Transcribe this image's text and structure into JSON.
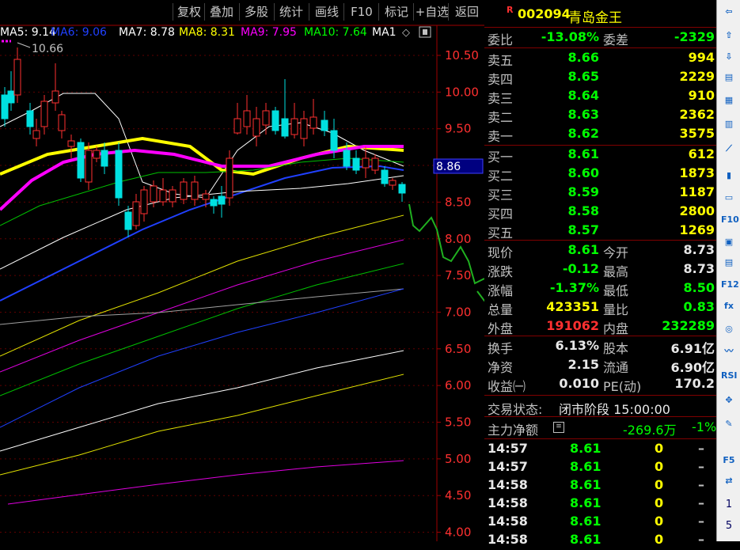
{
  "toolbar": {
    "items": [
      "复权",
      "叠加",
      "多股",
      "统计",
      "画线",
      "F10",
      "标记",
      "+自选",
      "返回"
    ]
  },
  "ma_legend": [
    {
      "label": "MA5: 9.14",
      "color": "#ffffff"
    },
    {
      "label": "MA6: 9.06",
      "color": "#2040ff"
    },
    {
      "label": "MA7: 8.78",
      "color": "#ffffff"
    },
    {
      "label": "MA8: 8.31",
      "color": "#ffff00"
    },
    {
      "label": "MA9: 7.95",
      "color": "#ff00ff"
    },
    {
      "label": "MA10: 7.64",
      "color": "#00ff00"
    },
    {
      "label": "MA1",
      "color": "#ffffff"
    }
  ],
  "high_marker": "10.66",
  "price_axis": [
    "10.50",
    "10.00",
    "9.50",
    "9.00",
    "8.50",
    "8.00",
    "7.50",
    "7.00",
    "6.50",
    "6.00",
    "5.50",
    "5.00",
    "4.50",
    "4.00"
  ],
  "current_price_tag": "8.86",
  "stock": {
    "badge": "R",
    "code": "002094",
    "name": "青岛金王"
  },
  "weibi": {
    "l1": "委比",
    "v1": "-13.08%",
    "l2": "委差",
    "v2": "-2329"
  },
  "asks": [
    {
      "label": "卖五",
      "price": "8.66",
      "vol": "994"
    },
    {
      "label": "卖四",
      "price": "8.65",
      "vol": "2229"
    },
    {
      "label": "卖三",
      "price": "8.64",
      "vol": "910"
    },
    {
      "label": "卖二",
      "price": "8.63",
      "vol": "2362"
    },
    {
      "label": "卖一",
      "price": "8.62",
      "vol": "3575"
    }
  ],
  "bids": [
    {
      "label": "买一",
      "price": "8.61",
      "vol": "612"
    },
    {
      "label": "买二",
      "price": "8.60",
      "vol": "1873"
    },
    {
      "label": "买三",
      "price": "8.59",
      "vol": "1187"
    },
    {
      "label": "买四",
      "price": "8.58",
      "vol": "2800"
    },
    {
      "label": "买五",
      "price": "8.57",
      "vol": "1269"
    }
  ],
  "quote": [
    {
      "l1": "现价",
      "v1": "8.61",
      "l2": "今开",
      "v2": "8.73"
    },
    {
      "l1": "涨跌",
      "v1": "-0.12",
      "l2": "最高",
      "v2": "8.73"
    },
    {
      "l1": "涨幅",
      "v1": "-1.37%",
      "l2": "最低",
      "v2": "8.50"
    },
    {
      "l1": "总量",
      "v1": "423351",
      "l2": "量比",
      "v2": "0.83"
    },
    {
      "l1": "外盘",
      "v1": "191062",
      "l2": "内盘",
      "v2": "232289"
    }
  ],
  "fund": [
    {
      "l1": "换手",
      "v1": "6.13%",
      "l2": "股本",
      "v2": "6.91亿"
    },
    {
      "l1": "净资",
      "v1": "2.15",
      "l2": "流通",
      "v2": "6.90亿"
    },
    {
      "l1": "收益㈠",
      "v1": "0.010",
      "l2": "PE(动)",
      "v2": "170.2"
    }
  ],
  "status": {
    "label": "交易状态:",
    "value": "闭市阶段 15:00:00"
  },
  "mainflow": {
    "label": "主力净额",
    "value": "-269.6万",
    "pct": "-1%"
  },
  "ticks": [
    {
      "time": "14:57",
      "price": "8.61",
      "vol": "0",
      "dir": "–"
    },
    {
      "time": "14:57",
      "price": "8.61",
      "vol": "0",
      "dir": "–"
    },
    {
      "time": "14:58",
      "price": "8.61",
      "vol": "0",
      "dir": "–"
    },
    {
      "time": "14:58",
      "price": "8.61",
      "vol": "0",
      "dir": "–"
    },
    {
      "time": "14:58",
      "price": "8.61",
      "vol": "0",
      "dir": "–"
    },
    {
      "time": "14:58",
      "price": "8.61",
      "vol": "0",
      "dir": "–"
    }
  ],
  "sidebar": [
    {
      "icon": "arrow-left-icon",
      "glyph": "⇦"
    },
    {
      "icon": "arrow-up-icon",
      "glyph": "⇧"
    },
    {
      "icon": "arrow-down-icon",
      "glyph": "⇩"
    },
    {
      "icon": "quote-list-icon",
      "glyph": "▤"
    },
    {
      "icon": "grid-icon",
      "glyph": "▦"
    },
    {
      "icon": "table-icon",
      "glyph": "▥"
    },
    {
      "icon": "line-chart-icon",
      "glyph": "⟋"
    },
    {
      "icon": "kline-icon",
      "glyph": "▮"
    },
    {
      "icon": "news-icon",
      "glyph": "▭"
    },
    {
      "icon": "f10-icon",
      "glyph": "F10"
    },
    {
      "icon": "notes-icon",
      "glyph": "▣"
    },
    {
      "icon": "calendar-icon",
      "glyph": "▤"
    },
    {
      "icon": "f12-icon",
      "glyph": "F12"
    },
    {
      "icon": "function-icon",
      "glyph": "fx"
    },
    {
      "icon": "refresh-icon",
      "glyph": "◎"
    },
    {
      "icon": "wave-icon",
      "glyph": "〰"
    },
    {
      "icon": "rsi-icon",
      "glyph": "RSI"
    },
    {
      "icon": "move-icon",
      "glyph": "✥"
    },
    {
      "icon": "pencil-icon",
      "glyph": "✎"
    },
    {
      "icon": "f5-icon",
      "glyph": "F5"
    },
    {
      "icon": "switch-icon",
      "glyph": "⇄"
    },
    {
      "icon": "page-one",
      "glyph": "1"
    },
    {
      "icon": "page-five",
      "glyph": "5"
    }
  ]
}
